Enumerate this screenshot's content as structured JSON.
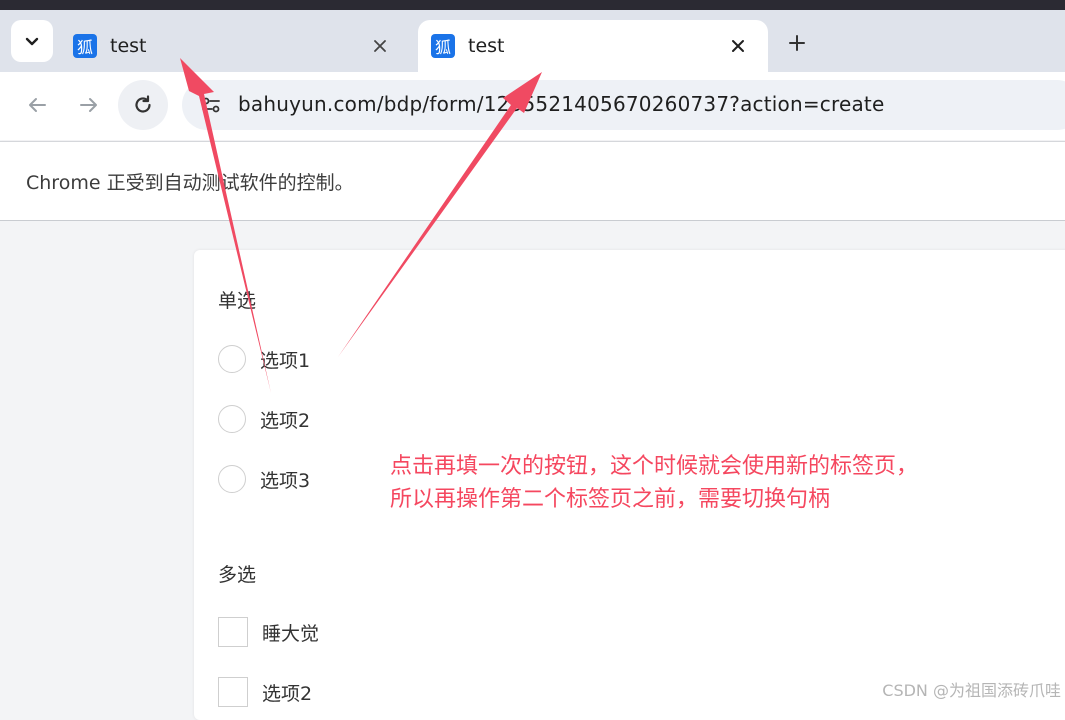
{
  "browser": {
    "tabs": [
      {
        "title": "test",
        "favicon": "狐",
        "active": false
      },
      {
        "title": "test",
        "favicon": "狐",
        "active": true
      }
    ],
    "url": "bahuyun.com/bdp/form/1235521405670260737?action=create",
    "infobar": "Chrome 正受到自动测试软件的控制。"
  },
  "form": {
    "single_title": "单选",
    "single_options": [
      "选项1",
      "选项2",
      "选项3"
    ],
    "multi_title": "多选",
    "multi_options": [
      "睡大觉",
      "选项2"
    ]
  },
  "annotation": {
    "line1": "点击再填一次的按钮，这个时候就会使用新的标签页，",
    "line2": "所以再操作第二个标签页之前，需要切换句柄",
    "color": "#f5475f"
  },
  "watermark": "CSDN @为祖国添砖爪哇",
  "icons": [
    "chevron-down-icon",
    "close-icon",
    "plus-icon",
    "back-icon",
    "forward-icon",
    "reload-icon",
    "site-info-icon",
    "arrow-annotation-icon"
  ]
}
